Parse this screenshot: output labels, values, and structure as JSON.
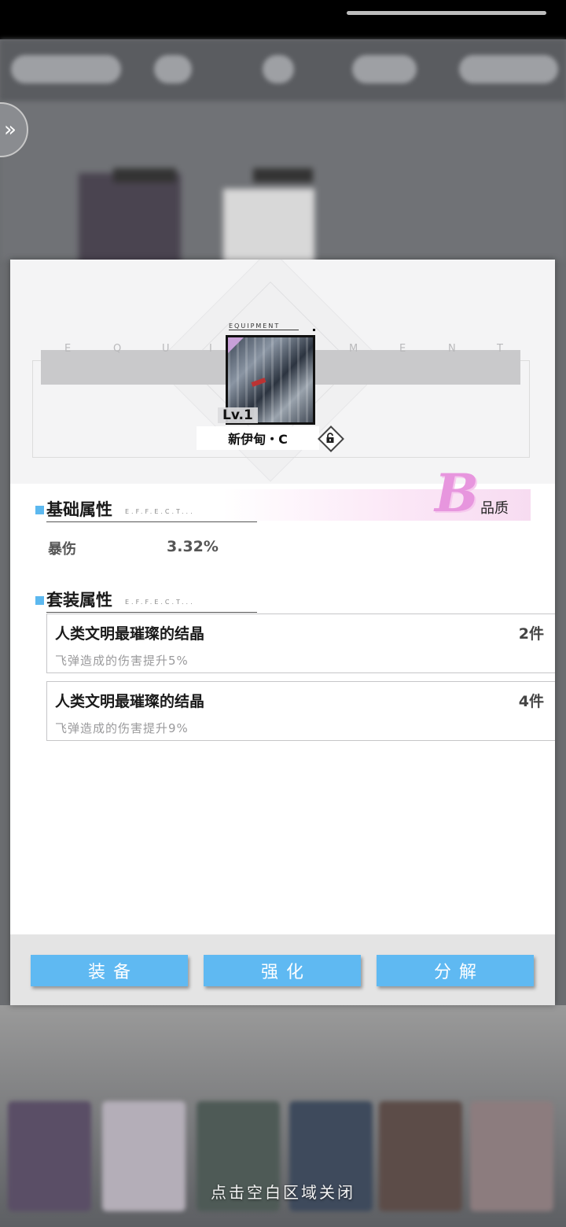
{
  "overlay": {
    "close_hint": "点击空白区域关闭"
  },
  "item": {
    "header_small": "EQUIPMENT",
    "header_letters": [
      "E",
      "Q",
      "U",
      "I",
      "P",
      "M",
      "E",
      "N",
      "T"
    ],
    "level": "Lv.1",
    "name": "新伊甸・C",
    "lock_icon": "unlock-icon",
    "quality_grade": "B",
    "quality_label": "品质",
    "quality_color": "#e796de"
  },
  "base_section": {
    "title": "基础属性",
    "effect_tag": "E.F.F.E.C.T...",
    "stats": [
      {
        "name": "暴伤",
        "value": "3.32%"
      }
    ]
  },
  "set_section": {
    "title": "套装属性",
    "effect_tag": "E.F.F.E.C.T...",
    "sets": [
      {
        "name": "人类文明最璀璨的结晶",
        "count": "2件",
        "desc": "飞弹造成的伤害提升5%"
      },
      {
        "name": "人类文明最璀璨的结晶",
        "count": "4件",
        "desc": "飞弹造成的伤害提升9%"
      }
    ]
  },
  "actions": {
    "equip": "装备",
    "enhance": "强化",
    "dismantle": "分解",
    "accent": "#5fb9f2"
  }
}
